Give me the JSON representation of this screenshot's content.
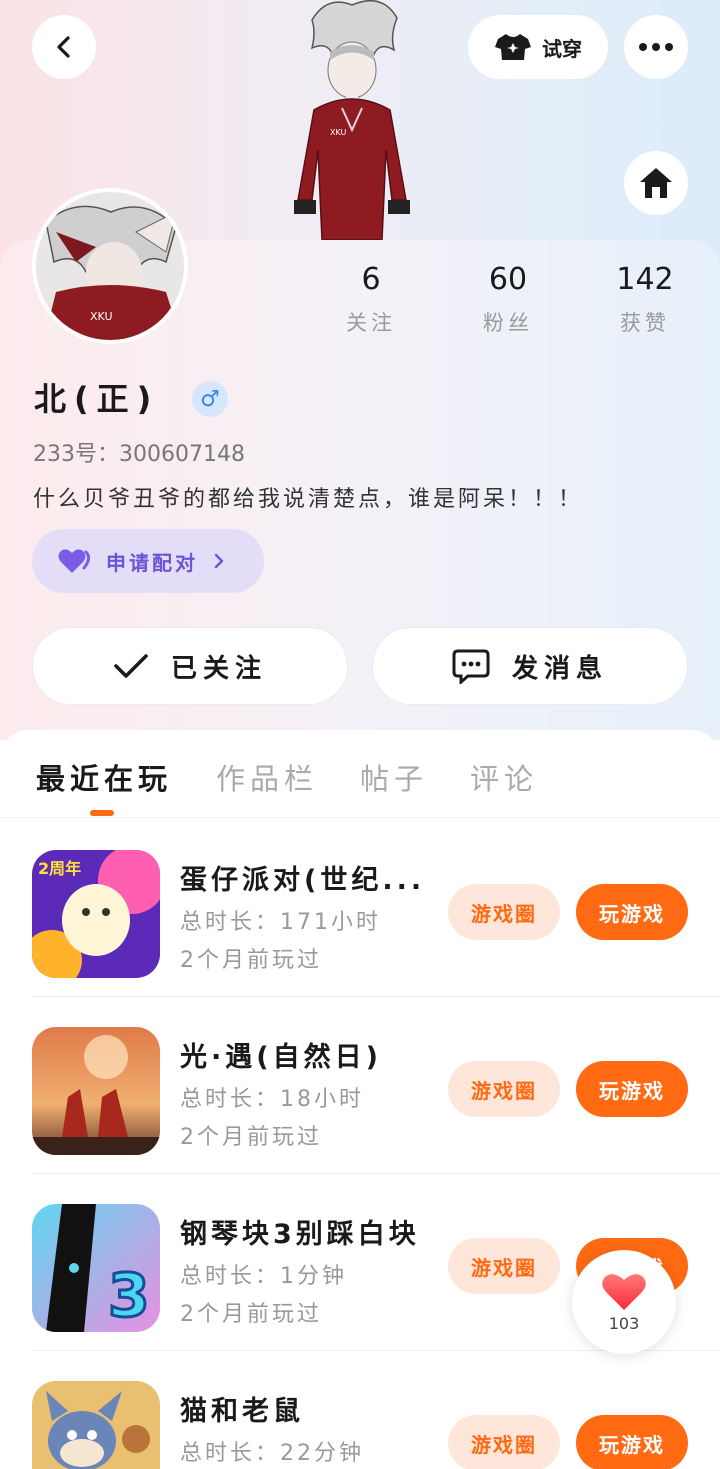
{
  "header": {
    "tryon_label": "试穿"
  },
  "profile": {
    "stats": [
      {
        "value": "6",
        "label": "关注"
      },
      {
        "value": "60",
        "label": "粉丝"
      },
      {
        "value": "142",
        "label": "获赞"
      }
    ],
    "username": "北(正)",
    "gender_symbol": "♂",
    "uid": "233号：300607148",
    "bio": "什么贝爷丑爷的都给我说清楚点，谁是阿呆！！！",
    "pair_label": "申请配对",
    "follow_label": "已关注",
    "message_label": "发消息"
  },
  "tabs": [
    {
      "label": "最近在玩",
      "active": true
    },
    {
      "label": "作品栏",
      "active": false
    },
    {
      "label": "帖子",
      "active": false
    },
    {
      "label": "评论",
      "active": false
    }
  ],
  "games": [
    {
      "title": "蛋仔派对(世纪...",
      "duration": "总时长：171小时",
      "last_played": "2个月前玩过",
      "circle_label": "游戏圈",
      "play_label": "玩游戏"
    },
    {
      "title": "光·遇(自然日)",
      "duration": "总时长：18小时",
      "last_played": "2个月前玩过",
      "circle_label": "游戏圈",
      "play_label": "玩游戏"
    },
    {
      "title": "钢琴块3别踩白块",
      "duration": "总时长：1分钟",
      "last_played": "2个月前玩过",
      "circle_label": "游戏圈",
      "play_label": "玩游戏"
    },
    {
      "title": "猫和老鼠",
      "duration": "总时长：22分钟",
      "last_played": "",
      "circle_label": "游戏圈",
      "play_label": "玩游戏"
    }
  ],
  "like_fab": {
    "count": "103"
  },
  "colors": {
    "accent": "#ff6a13",
    "pair": "#6a55d8",
    "gender": "#3a86e8"
  },
  "icons": [
    "back-arrow-icon",
    "tshirt-icon",
    "more-dots-icon",
    "home-icon",
    "purple-heart-icon",
    "chevron-right-icon",
    "check-icon",
    "chat-bubble-icon",
    "red-heart-icon"
  ]
}
